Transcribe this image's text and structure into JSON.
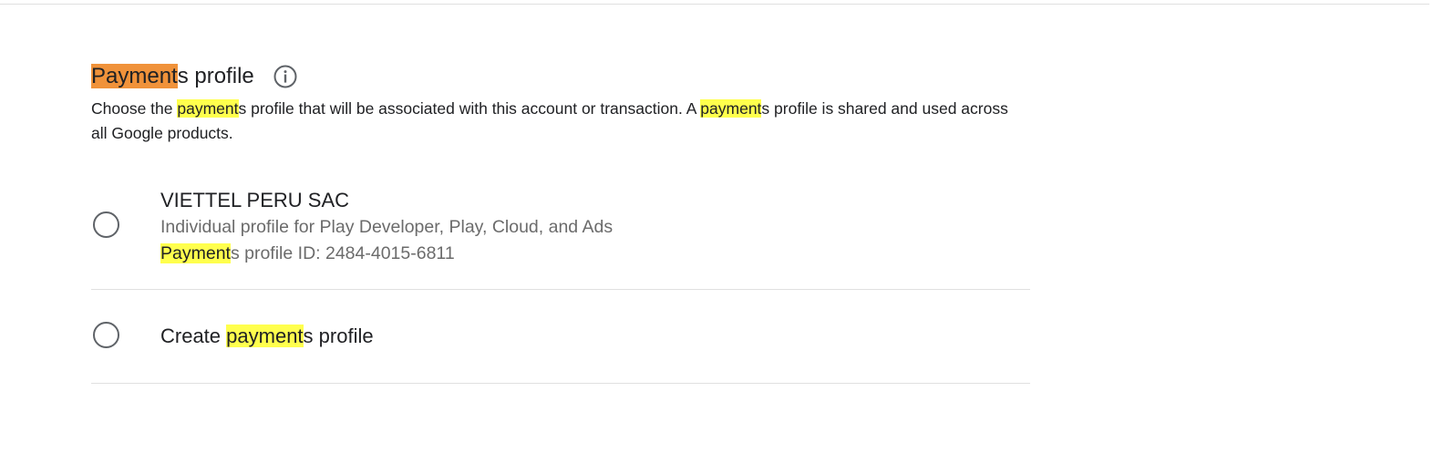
{
  "header": {
    "title_highlight": "Payment",
    "title_rest": "s profile",
    "info_icon": "info-circle-icon"
  },
  "description": {
    "part1": "Choose the ",
    "hl1": "payment",
    "part2": "s profile that will be associated with this account or transaction. A ",
    "hl2": "payment",
    "part3": "s profile is shared and used across all Google products."
  },
  "profile_option": {
    "name": "VIETTEL PERU SAC",
    "subtitle": "Individual profile for Play Developer, Play, Cloud, and Ads",
    "id_highlight": "Payment",
    "id_rest": "s profile ID: 2484-4015-6811",
    "selected": false
  },
  "create_option": {
    "prefix": "Create ",
    "highlight": "payment",
    "suffix": "s profile",
    "selected": false
  },
  "colors": {
    "highlight_current": "#f0923a",
    "highlight_match": "#ffff4d",
    "divider": "#e0e0e0",
    "secondary_text": "#6b6b6b"
  }
}
